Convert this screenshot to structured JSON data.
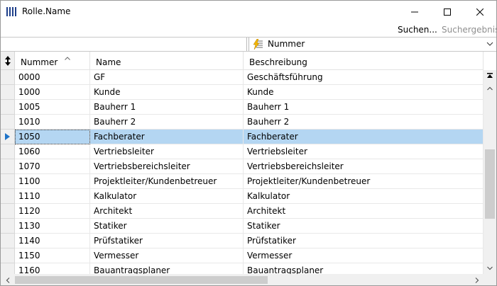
{
  "window": {
    "title": "Rolle.Name",
    "icon": "table-columns-icon"
  },
  "toolbar": {
    "search_label": "Suchen...",
    "result_label": "Suchergebnis"
  },
  "filter": {
    "search_value": "",
    "field_selected": "Nummer",
    "field_icon": "lightning-list-icon"
  },
  "grid": {
    "columns": [
      "Nummer",
      "Name",
      "Beschreibung"
    ],
    "sorted_column": "Nummer",
    "selected_row_index": 4,
    "rows": [
      {
        "nummer": "0000",
        "name": "GF",
        "beschreibung": "Geschäftsführung"
      },
      {
        "nummer": "1000",
        "name": "Kunde",
        "beschreibung": "Kunde"
      },
      {
        "nummer": "1005",
        "name": "Bauherr 1",
        "beschreibung": "Bauherr 1"
      },
      {
        "nummer": "1010",
        "name": "Bauherr 2",
        "beschreibung": "Bauherr 2"
      },
      {
        "nummer": "1050",
        "name": "Fachberater",
        "beschreibung": "Fachberater"
      },
      {
        "nummer": "1060",
        "name": "Vertriebsleiter",
        "beschreibung": "Vertriebsleiter"
      },
      {
        "nummer": "1070",
        "name": "Vertriebsbereichsleiter",
        "beschreibung": "Vertriebsbereichsleiter"
      },
      {
        "nummer": "1100",
        "name": "Projektleiter/Kundenbetreuer",
        "beschreibung": "Projektleiter/Kundenbetreuer"
      },
      {
        "nummer": "1110",
        "name": "Kalkulator",
        "beschreibung": "Kalkulator"
      },
      {
        "nummer": "1120",
        "name": "Architekt",
        "beschreibung": "Architekt"
      },
      {
        "nummer": "1130",
        "name": "Statiker",
        "beschreibung": "Statiker"
      },
      {
        "nummer": "1140",
        "name": "Prüfstatiker",
        "beschreibung": "Prüfstatiker"
      },
      {
        "nummer": "1150",
        "name": "Vermesser",
        "beschreibung": "Vermesser"
      },
      {
        "nummer": "1160",
        "name": "Bauantragsplaner",
        "beschreibung": "Bauantragsplaner"
      }
    ]
  },
  "colors": {
    "selection": "#b4d6f2",
    "row_pointer": "#1e73c8",
    "icon_blue": "#1e3f8a"
  }
}
